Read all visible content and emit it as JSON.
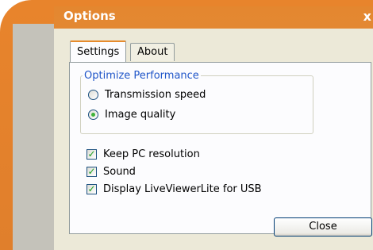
{
  "window": {
    "title": "Options",
    "close_glyph": "x"
  },
  "tabs": [
    {
      "label": "Settings",
      "active": true
    },
    {
      "label": "About",
      "active": false
    }
  ],
  "optimize_group": {
    "legend": "Optimize Performance",
    "options": [
      {
        "label": "Transmission speed",
        "selected": false
      },
      {
        "label": "Image quality",
        "selected": true
      }
    ]
  },
  "checkboxes": [
    {
      "label": "Keep PC resolution",
      "checked": true
    },
    {
      "label": "Sound",
      "checked": true
    },
    {
      "label": "Display LiveViewerLite for USB",
      "checked": true
    }
  ],
  "buttons": {
    "close_label": "Close"
  },
  "colors": {
    "frame_orange": "#e4872f",
    "legend_blue": "#1f55c8",
    "check_green": "#21a121"
  }
}
